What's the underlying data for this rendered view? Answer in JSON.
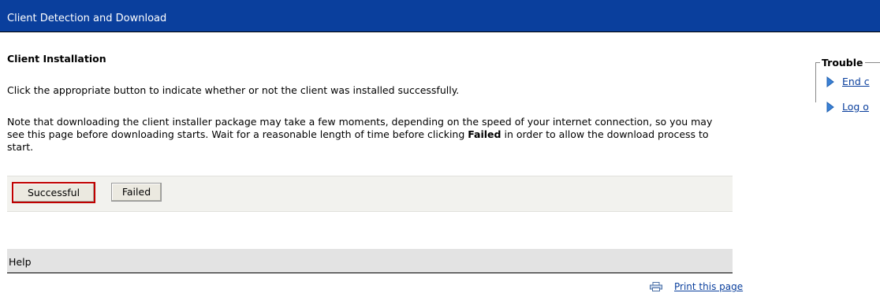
{
  "header": {
    "title": "Client Detection and Download"
  },
  "content": {
    "heading": "Client Installation",
    "paragraph1": "Click the appropriate button to indicate whether or not the client was installed successfully.",
    "paragraph2_before": "Note that downloading the client installer package may take a few moments, depending on the speed of your internet connection, so you may see this page before downloading starts. Wait for a reasonable length of time before clicking ",
    "paragraph2_bold": "Failed",
    "paragraph2_after": " in order to allow the download process to start."
  },
  "buttons": {
    "successful": "Successful",
    "failed": "Failed"
  },
  "help": {
    "label": "Help"
  },
  "print": {
    "label": "Print this page",
    "icon": "printer-icon"
  },
  "troubleshooting": {
    "title": "Trouble",
    "links": [
      {
        "label": "End c"
      },
      {
        "label": "Log o"
      }
    ]
  },
  "colors": {
    "header_bg": "#0a3f9d",
    "link": "#0a3f9d",
    "button_focus_border": "#c00000"
  }
}
